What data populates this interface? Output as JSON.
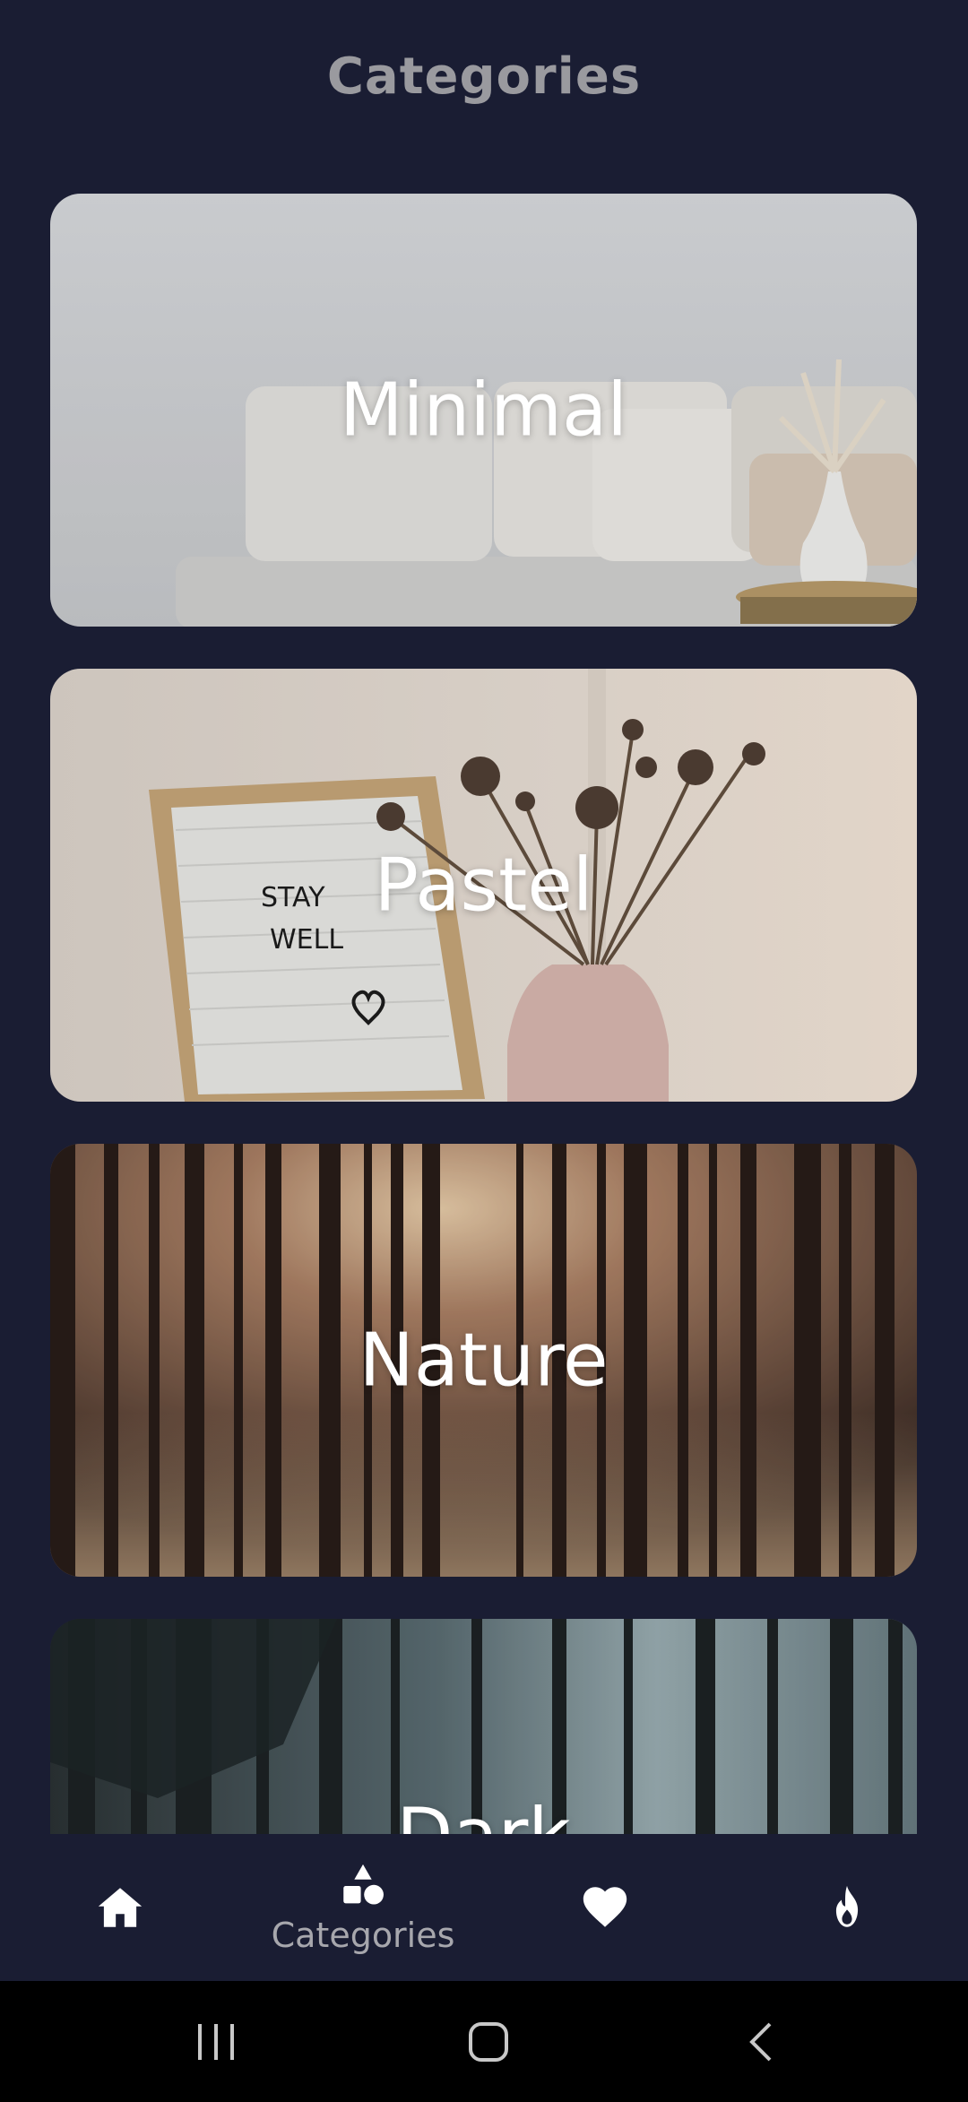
{
  "header": {
    "title": "Categories"
  },
  "categories": [
    {
      "label": "Minimal"
    },
    {
      "label": "Pastel"
    },
    {
      "label": "Nature"
    },
    {
      "label": "Dark"
    }
  ],
  "bottom_nav": {
    "items": [
      {
        "icon": "home-icon",
        "label": ""
      },
      {
        "icon": "shapes-icon",
        "label": "Categories"
      },
      {
        "icon": "heart-icon",
        "label": ""
      },
      {
        "icon": "flame-icon",
        "label": ""
      }
    ],
    "active_index": 1
  },
  "letter_board": {
    "line1": "STAY",
    "line2": "WELL"
  },
  "colors": {
    "background": "#1a1d33",
    "title": "#9a9a9f",
    "nav_label": "#a7a7ad"
  }
}
